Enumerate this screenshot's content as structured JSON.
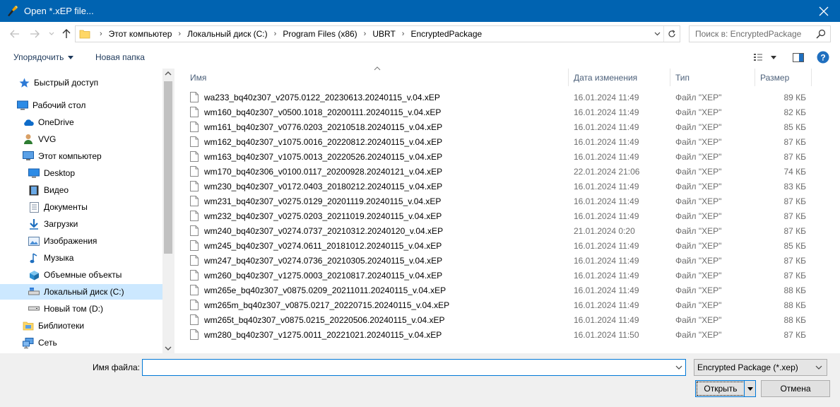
{
  "window": {
    "title": "Open *.xEP file..."
  },
  "address": {
    "crumbs": [
      "Этот компьютер",
      "Локальный диск (C:)",
      "Program Files (x86)",
      "UBRT",
      "EncryptedPackage"
    ]
  },
  "search": {
    "placeholder": "Поиск в: EncryptedPackage"
  },
  "toolbar": {
    "organize_label": "Упорядочить",
    "new_folder_label": "Новая папка"
  },
  "nav": {
    "items": [
      {
        "label": "Быстрый доступ",
        "icon": "star-icon"
      },
      {
        "label": "Рабочий стол",
        "icon": "desktop-icon"
      },
      {
        "label": "OneDrive",
        "icon": "cloud-icon"
      },
      {
        "label": "VVG",
        "icon": "user-icon"
      },
      {
        "label": "Этот компьютер",
        "icon": "computer-icon"
      },
      {
        "label": "Desktop",
        "icon": "desktop-icon"
      },
      {
        "label": "Видео",
        "icon": "video-icon"
      },
      {
        "label": "Документы",
        "icon": "documents-icon"
      },
      {
        "label": "Загрузки",
        "icon": "download-icon"
      },
      {
        "label": "Изображения",
        "icon": "pictures-icon"
      },
      {
        "label": "Музыка",
        "icon": "music-icon"
      },
      {
        "label": "Объемные объекты",
        "icon": "3d-objects-icon"
      },
      {
        "label": "Локальный диск (C:)",
        "icon": "drive-icon"
      },
      {
        "label": "Новый том (D:)",
        "icon": "drive-icon"
      },
      {
        "label": "Библиотеки",
        "icon": "libraries-icon"
      },
      {
        "label": "Сеть",
        "icon": "network-icon"
      }
    ]
  },
  "columns": {
    "name": "Имя",
    "date": "Дата изменения",
    "type": "Тип",
    "size": "Размер"
  },
  "files": [
    {
      "name": "wa233_bq40z307_v2075.0122_20230613.20240115_v.04.xEP",
      "date": "16.01.2024 11:49",
      "type": "Файл \"XEP\"",
      "size": "89 КБ"
    },
    {
      "name": "wm160_bq40z307_v0500.1018_20200111.20240115_v.04.xEP",
      "date": "16.01.2024 11:49",
      "type": "Файл \"XEP\"",
      "size": "82 КБ"
    },
    {
      "name": "wm161_bq40z307_v0776.0203_20210518.20240115_v.04.xEP",
      "date": "16.01.2024 11:49",
      "type": "Файл \"XEP\"",
      "size": "85 КБ"
    },
    {
      "name": "wm162_bq40z307_v1075.0016_20220812.20240115_v.04.xEP",
      "date": "16.01.2024 11:49",
      "type": "Файл \"XEP\"",
      "size": "87 КБ"
    },
    {
      "name": "wm163_bq40z307_v1075.0013_20220526.20240115_v.04.xEP",
      "date": "16.01.2024 11:49",
      "type": "Файл \"XEP\"",
      "size": "87 КБ"
    },
    {
      "name": "wm170_bq40z306_v0100.0117_20200928.20240121_v.04.xEP",
      "date": "22.01.2024 21:06",
      "type": "Файл \"XEP\"",
      "size": "74 КБ"
    },
    {
      "name": "wm230_bq40z307_v0172.0403_20180212.20240115_v.04.xEP",
      "date": "16.01.2024 11:49",
      "type": "Файл \"XEP\"",
      "size": "83 КБ"
    },
    {
      "name": "wm231_bq40z307_v0275.0129_20201119.20240115_v.04.xEP",
      "date": "16.01.2024 11:49",
      "type": "Файл \"XEP\"",
      "size": "87 КБ"
    },
    {
      "name": "wm232_bq40z307_v0275.0203_20211019.20240115_v.04.xEP",
      "date": "16.01.2024 11:49",
      "type": "Файл \"XEP\"",
      "size": "87 КБ"
    },
    {
      "name": "wm240_bq40z307_v0274.0737_20210312.20240120_v.04.xEP",
      "date": "21.01.2024 0:20",
      "type": "Файл \"XEP\"",
      "size": "87 КБ"
    },
    {
      "name": "wm245_bq40z307_v0274.0611_20181012.20240115_v.04.xEP",
      "date": "16.01.2024 11:49",
      "type": "Файл \"XEP\"",
      "size": "85 КБ"
    },
    {
      "name": "wm247_bq40z307_v0274.0736_20210305.20240115_v.04.xEP",
      "date": "16.01.2024 11:49",
      "type": "Файл \"XEP\"",
      "size": "87 КБ"
    },
    {
      "name": "wm260_bq40z307_v1275.0003_20210817.20240115_v.04.xEP",
      "date": "16.01.2024 11:49",
      "type": "Файл \"XEP\"",
      "size": "87 КБ"
    },
    {
      "name": "wm265e_bq40z307_v0875.0209_20211011.20240115_v.04.xEP",
      "date": "16.01.2024 11:49",
      "type": "Файл \"XEP\"",
      "size": "88 КБ"
    },
    {
      "name": "wm265m_bq40z307_v0875.0217_20220715.20240115_v.04.xEP",
      "date": "16.01.2024 11:49",
      "type": "Файл \"XEP\"",
      "size": "88 КБ"
    },
    {
      "name": "wm265t_bq40z307_v0875.0215_20220506.20240115_v.04.xEP",
      "date": "16.01.2024 11:49",
      "type": "Файл \"XEP\"",
      "size": "88 КБ"
    },
    {
      "name": "wm280_bq40z307_v1275.0011_20221021.20240115_v.04.xEP",
      "date": "16.01.2024 11:50",
      "type": "Файл \"XEP\"",
      "size": "87 КБ"
    }
  ],
  "bottom": {
    "filename_label": "Имя файла:",
    "filename_value": "",
    "filter_selected": "Encrypted Package (*.xep)",
    "open_label": "Открыть",
    "cancel_label": "Отмена"
  },
  "colors": {
    "titlebar": "#0063b1",
    "selection": "#cce8ff",
    "accent": "#0078d7"
  }
}
